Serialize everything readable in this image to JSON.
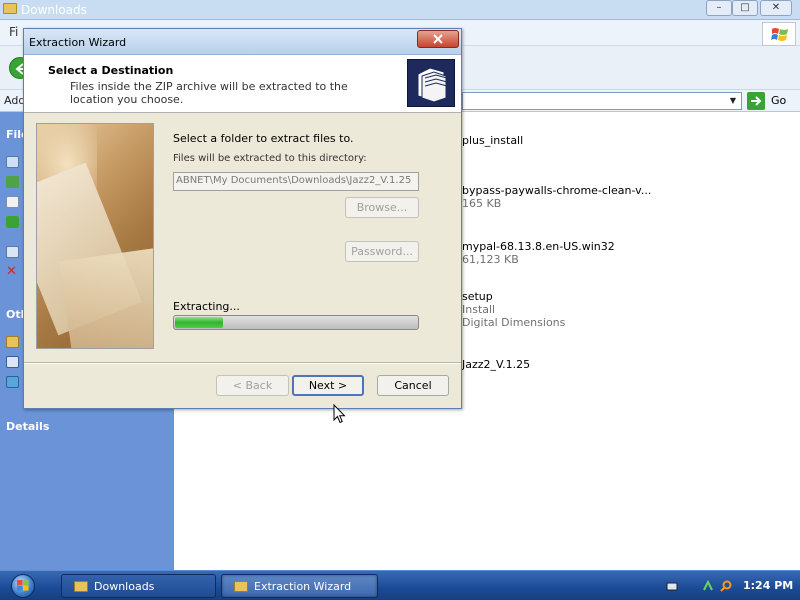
{
  "explorer": {
    "title": "Downloads",
    "menu_prefix": "Fi",
    "address_label": "Add",
    "go_label": "Go",
    "sidebar": {
      "header_file": "File",
      "header_other": "Oth",
      "header_details": "Details"
    },
    "files": [
      {
        "name": "plus_install",
        "meta1": "",
        "meta2": ""
      },
      {
        "name": "bypass-paywalls-chrome-clean-v...",
        "meta1": "165 KB",
        "meta2": ""
      },
      {
        "name": "mypal-68.13.8.en-US.win32",
        "meta1": "61,123 KB",
        "meta2": ""
      },
      {
        "name": "setup",
        "meta1": "Install",
        "meta2": "Digital Dimensions"
      },
      {
        "name": "Jazz2_V.1.25",
        "meta1": "",
        "meta2": ""
      }
    ]
  },
  "wizard": {
    "title": "Extraction Wizard",
    "heading": "Select a Destination",
    "subheading": "Files inside the ZIP archive will be extracted to the location you choose.",
    "prompt": "Select a folder to extract files to.",
    "path_label": "Files will be extracted to this directory:",
    "path_value": "ABNET\\My Documents\\Downloads\\Jazz2_V.1.25",
    "browse_label": "Browse...",
    "password_label": "Password...",
    "status_label": "Extracting...",
    "progress": 0.2,
    "back_label": "< Back",
    "next_label": "Next >",
    "cancel_label": "Cancel"
  },
  "taskbar": {
    "items": [
      {
        "label": "Downloads"
      },
      {
        "label": "Extraction Wizard"
      }
    ],
    "clock": "1:24 PM"
  },
  "icons": {
    "explorer_folder": "folder-icon",
    "back": "back-arrow-icon",
    "go": "go-arrow-icon",
    "windows_logo": "windows-flag-icon",
    "wizard_header": "folders-icon",
    "wizard_close": "close-icon",
    "start": "start-orb-icon",
    "tray": [
      "keyboard-icon",
      "network-icon",
      "search-icon"
    ],
    "cursor": "mouse-pointer-icon"
  },
  "colors": {
    "progress_fill": "#2fb52a",
    "sidebar_bg": "#6a93d8",
    "taskbar_bg": "#1b4a96",
    "close_btn": "#c6452e"
  }
}
